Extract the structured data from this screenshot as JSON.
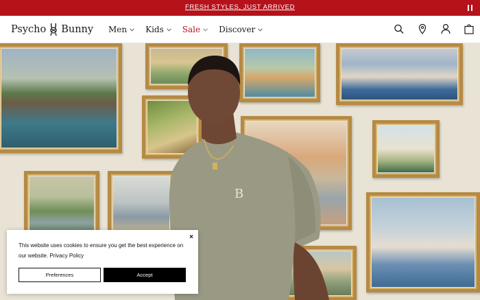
{
  "announcement": {
    "text": "FRESH STYLES, JUST ARRIVED"
  },
  "logo": {
    "left": "Psycho",
    "right": "Bunny"
  },
  "nav": [
    {
      "label": "Men"
    },
    {
      "label": "Kids"
    },
    {
      "label": "Sale"
    },
    {
      "label": "Discover"
    }
  ],
  "header_icons": [
    "search-icon",
    "location-icon",
    "account-icon",
    "cart-icon"
  ],
  "colors": {
    "brand_red": "#b5121b"
  },
  "cookie": {
    "message": "This website uses cookies to ensure you get the best experience on our website.",
    "link": "Privacy Policy",
    "preferences": "Preferences",
    "accept": "Accept",
    "close": "×"
  }
}
